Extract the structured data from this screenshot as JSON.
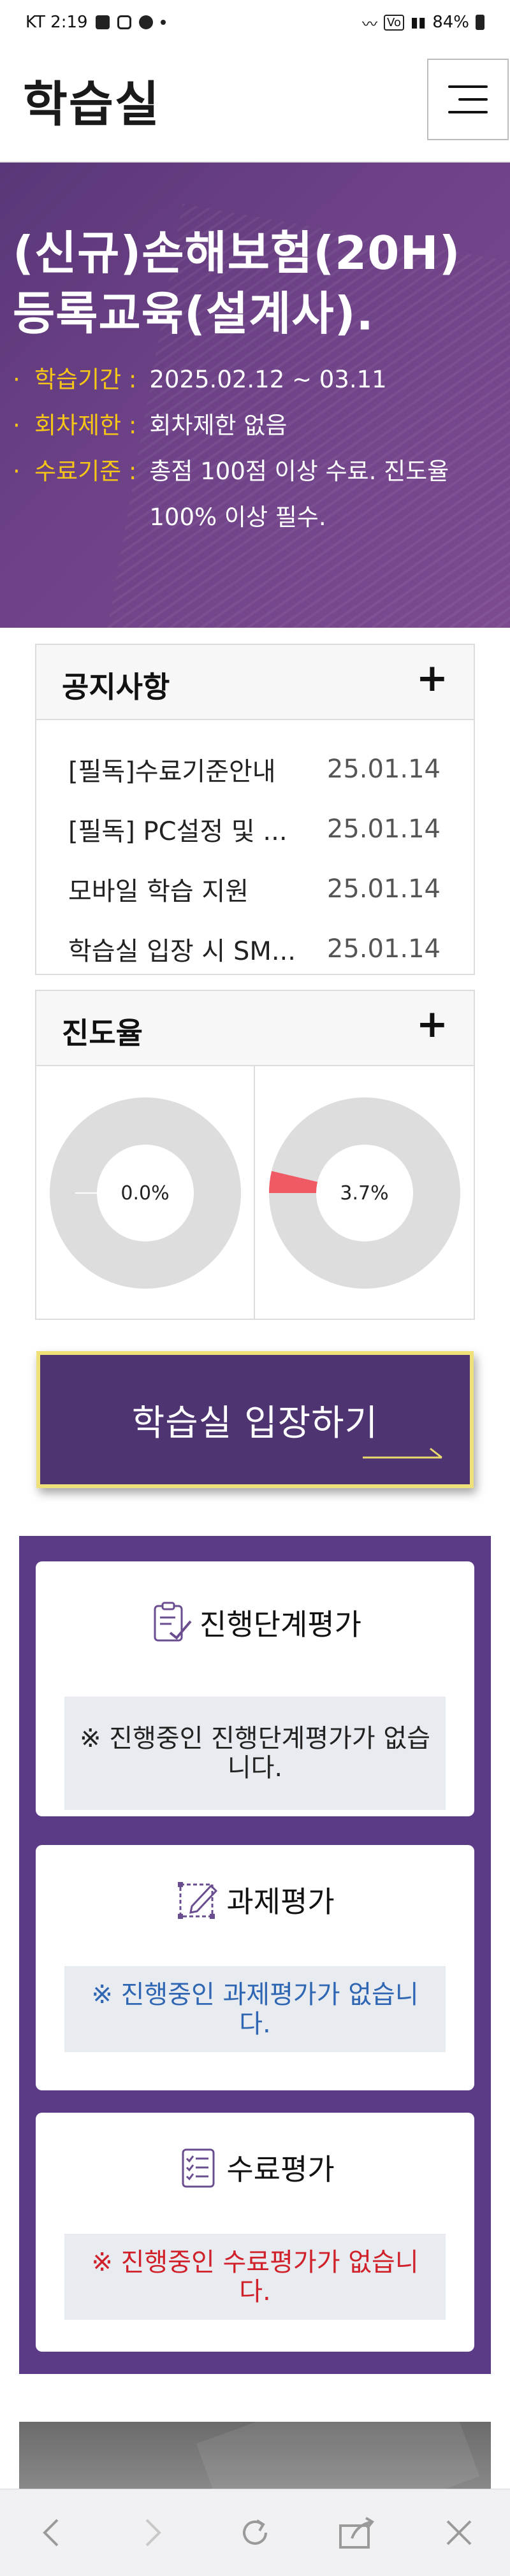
{
  "status_bar": {
    "carrier_time": "KT 2:19",
    "battery": "84%"
  },
  "header": {
    "title": "학습실",
    "menu_icon": "hamburger-icon"
  },
  "course": {
    "title": "(신규)손해보험(20H) 등록교육(설계사).",
    "info": [
      {
        "bullet": "·",
        "label": "학습기간 :",
        "value": "2025.02.12 ~ 03.11"
      },
      {
        "bullet": "·",
        "label": "회차제한 :",
        "value": "회차제한 없음"
      },
      {
        "bullet": "·",
        "label": "수료기준 :",
        "value": "총점 100점 이상 수료. 진도율 100% 이상 필수."
      }
    ]
  },
  "notice": {
    "title": "공지사항",
    "plus": "+",
    "items": [
      {
        "title": "[필독]수료기준안내",
        "date": "25.01.14"
      },
      {
        "title": "[필독] PC설정 및 ...",
        "date": "25.01.14"
      },
      {
        "title": "모바일 학습 지원",
        "date": "25.01.14"
      },
      {
        "title": "학습실 입장 시 SM...",
        "date": "25.01.14"
      }
    ]
  },
  "progress": {
    "title": "진도율",
    "plus": "+",
    "charts": [
      {
        "label": "0.0%",
        "value": 0.0
      },
      {
        "label": "3.7%",
        "value": 3.7
      }
    ],
    "colors": {
      "track": "#dddddd",
      "fill": "#f05a64"
    }
  },
  "enter_button": {
    "label": "학습실 입장하기"
  },
  "evaluations": [
    {
      "title": "진행단계평가",
      "icon": "clipboard-check-icon",
      "message": "※ 진행중인 진행단계평가가 없습니다."
    },
    {
      "title": "과제평가",
      "icon": "edit-pencil-icon",
      "message": "※ 진행중인 과제평가가 없습니다."
    },
    {
      "title": "수료평가",
      "icon": "checklist-icon",
      "message": "※ 진행중인 수료평가가 없습니다."
    }
  ],
  "colors": {
    "brand_purple": "#5b3a86",
    "accent_yellow": "#f5c518",
    "assignment_blue": "#2f66b3",
    "completion_red": "#d0202a"
  }
}
